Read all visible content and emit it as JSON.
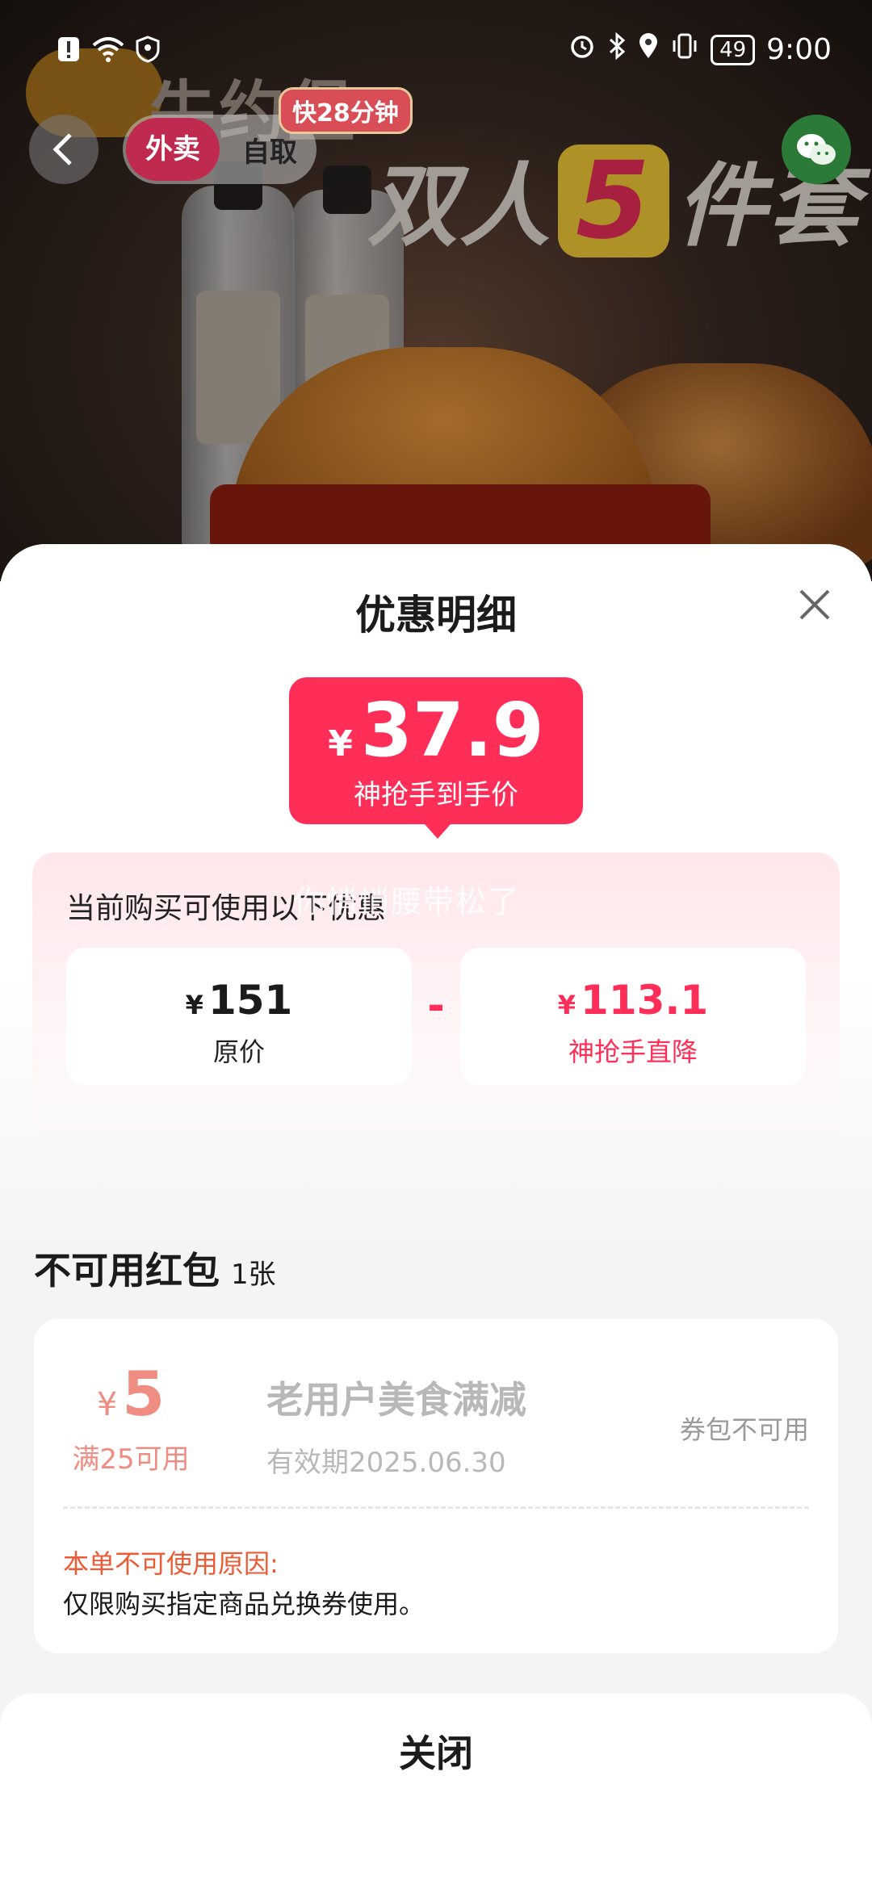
{
  "status_bar": {
    "time": "9:00",
    "battery": "49",
    "left_icons": [
      "alert-icon",
      "wifi-icon",
      "shield-icon"
    ],
    "right_icons": [
      "alarm-icon",
      "bluetooth-icon",
      "location-icon",
      "vibrate-icon"
    ]
  },
  "header": {
    "mode_tabs": [
      {
        "label": "外卖",
        "active": true
      },
      {
        "label": "自取",
        "active": false
      }
    ],
    "eta_badge": "快28分钟"
  },
  "banner": {
    "brand_text": "牛约堡",
    "promo_prefix": "双人",
    "promo_number": "5",
    "promo_suffix": "件套"
  },
  "sheet": {
    "title": "优惠明细",
    "final_price": {
      "currency": "¥",
      "value": "37.9",
      "label": "神抢手到手价"
    },
    "discount_panel": {
      "title": "当前购买可使用以下优惠",
      "watermark": "你悄悄腰带松了",
      "original": {
        "currency": "¥",
        "value": "151",
        "label": "原价"
      },
      "operator": "-",
      "reduction": {
        "currency": "¥",
        "value": "113.1",
        "label": "神抢手直降"
      }
    },
    "unusable": {
      "title": "不可用红包",
      "count": "1张",
      "coupons": [
        {
          "currency": "¥",
          "amount": "5",
          "condition": "满25可用",
          "name": "老用户美食满减",
          "validity": "有效期2025.06.30",
          "status": "券包不可用",
          "reason_title": "本单不可使用原因:",
          "reason_text": "仅限购买指定商品兑换券使用。"
        }
      ]
    },
    "close_label": "关闭"
  },
  "colors": {
    "accent": "#ff2e58",
    "coupon_amount": "#ef8d82",
    "reason": "#ec5a36"
  }
}
